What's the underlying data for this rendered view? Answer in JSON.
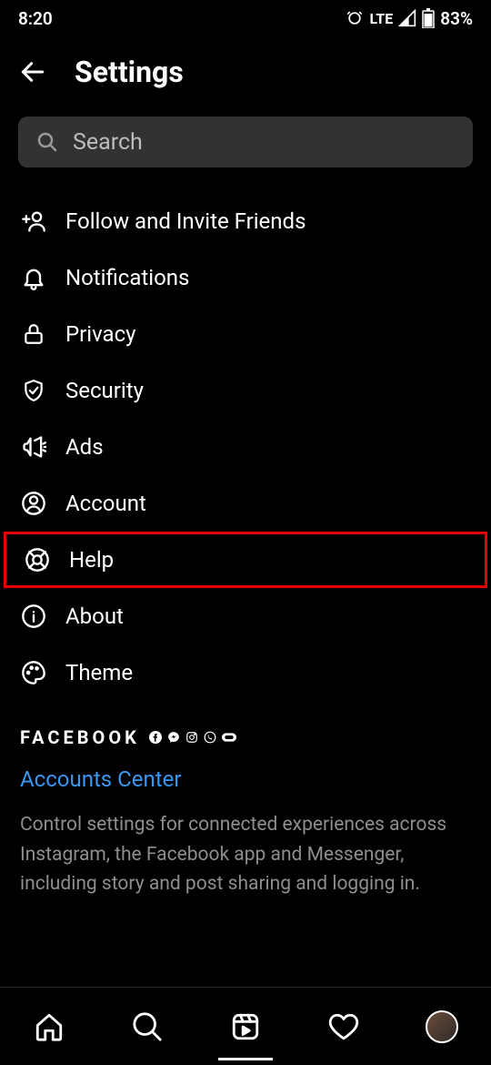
{
  "statusBar": {
    "time": "8:20",
    "network": "LTE",
    "battery": "83%"
  },
  "header": {
    "title": "Settings"
  },
  "search": {
    "placeholder": "Search"
  },
  "menu": {
    "items": [
      {
        "label": "Follow and Invite Friends"
      },
      {
        "label": "Notifications"
      },
      {
        "label": "Privacy"
      },
      {
        "label": "Security"
      },
      {
        "label": "Ads"
      },
      {
        "label": "Account"
      },
      {
        "label": "Help"
      },
      {
        "label": "About"
      },
      {
        "label": "Theme"
      }
    ]
  },
  "footer": {
    "brand": "FACEBOOK",
    "link": "Accounts Center",
    "description": "Control settings for connected experiences across Instagram, the Facebook app and Messenger, including story and post sharing and logging in."
  }
}
